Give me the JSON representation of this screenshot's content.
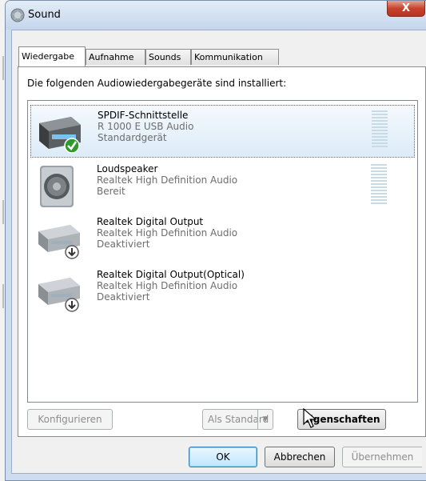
{
  "window": {
    "title": "Sound",
    "close_label": "X"
  },
  "tabs": [
    {
      "label": "Wiedergabe",
      "active": true
    },
    {
      "label": "Aufnahme",
      "active": false
    },
    {
      "label": "Sounds",
      "active": false
    },
    {
      "label": "Kommunikation",
      "active": false
    }
  ],
  "panel": {
    "description": "Die folgenden Audiowiedergabegeräte sind installiert:"
  },
  "devices": [
    {
      "name": "SPDIF-Schnittstelle",
      "driver": "R 1000 E  USB Audio",
      "status": "Standardgerät",
      "icon": "spdif-device-icon",
      "badge": "default-check-icon",
      "meter_level": 1.0,
      "selected": true
    },
    {
      "name": "Loudspeaker",
      "driver": "Realtek High Definition Audio",
      "status": "Bereit",
      "icon": "speaker-icon",
      "badge": null,
      "meter_level": 1.0,
      "selected": false
    },
    {
      "name": "Realtek Digital Output",
      "driver": "Realtek High Definition Audio",
      "status": "Deaktiviert",
      "icon": "digital-output-icon",
      "badge": "disabled-arrow-icon",
      "meter_level": null,
      "selected": false
    },
    {
      "name": "Realtek Digital Output(Optical)",
      "driver": "Realtek High Definition Audio",
      "status": "Deaktiviert",
      "icon": "digital-output-icon",
      "badge": "disabled-arrow-icon",
      "meter_level": null,
      "selected": false
    }
  ],
  "buttons": {
    "configure": "Konfigurieren",
    "set_default": "Als Standard",
    "properties": "Eigenschaften",
    "ok": "OK",
    "cancel": "Abbrechen",
    "apply": "Übernehmen"
  },
  "colors": {
    "titlebar": "#c4d6ec",
    "selection": "#dcebf8",
    "meter": "#c7dbe6",
    "check_green": "#2e9a2e"
  }
}
